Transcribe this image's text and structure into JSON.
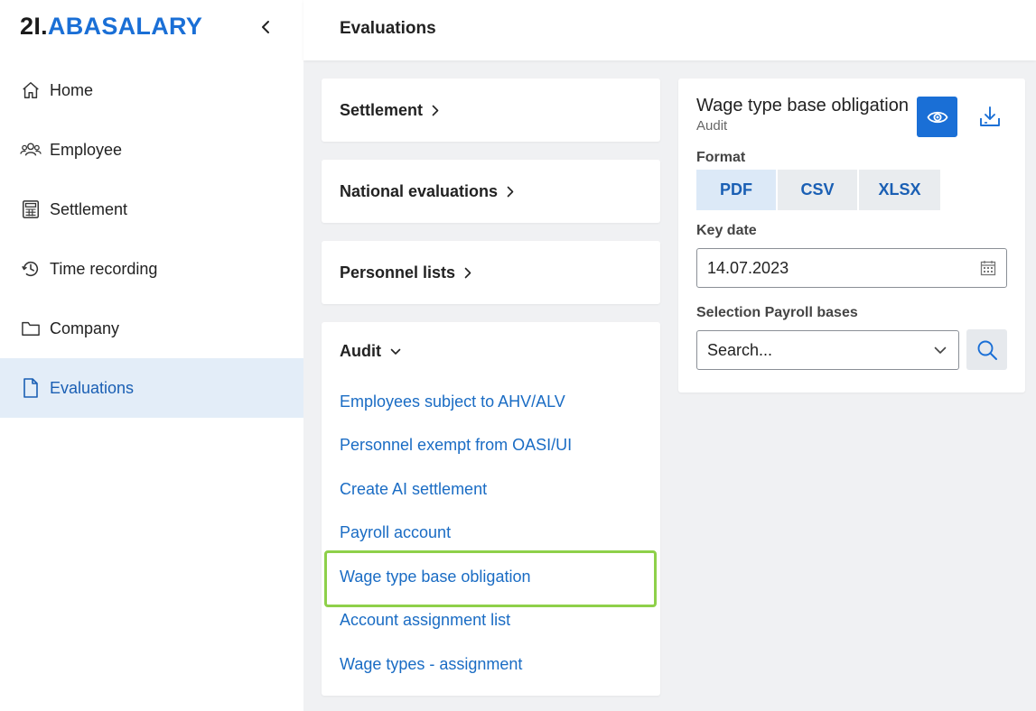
{
  "brand": {
    "part1": "2I.",
    "part2": "ABASALARY",
    "accent_color": "#1a6fd6"
  },
  "sidebar": {
    "collapse_icon": "chevron-left-icon",
    "items": [
      {
        "label": "Home",
        "icon": "home-icon"
      },
      {
        "label": "Employee",
        "icon": "users-icon"
      },
      {
        "label": "Settlement",
        "icon": "calculator-icon"
      },
      {
        "label": "Time recording",
        "icon": "history-icon"
      },
      {
        "label": "Company",
        "icon": "folder-icon"
      },
      {
        "label": "Evaluations",
        "icon": "document-icon",
        "active": true
      }
    ]
  },
  "header": {
    "title": "Evaluations"
  },
  "categories": [
    {
      "label": "Settlement",
      "icon": "chevron-right-icon"
    },
    {
      "label": "National evaluations",
      "icon": "chevron-right-icon"
    },
    {
      "label": "Personnel lists",
      "icon": "chevron-right-icon"
    }
  ],
  "audit": {
    "label": "Audit",
    "icon": "chevron-down-icon",
    "links": [
      "Employees subject to AHV/ALV",
      "Personnel exempt from OASI/UI",
      "Create AI settlement",
      "Payroll account",
      "Wage type base obligation",
      "Account assignment list",
      "Wage types - assignment"
    ],
    "highlighted_index": 4,
    "highlight_color": "#8ed04a"
  },
  "panel": {
    "title": "Wage type base obligation",
    "subtitle": "Audit",
    "preview_icon": "eye-icon",
    "download_icon": "download-icon",
    "format_label": "Format",
    "formats": [
      "PDF",
      "CSV",
      "XLSX"
    ],
    "selected_format": "PDF",
    "key_date_label": "Key date",
    "key_date_value": "14.07.2023",
    "calendar_icon": "calendar-icon",
    "selection_label": "Selection Payroll bases",
    "search_placeholder": "Search...",
    "dropdown_icon": "chevron-down-icon",
    "search_icon": "search-icon"
  }
}
